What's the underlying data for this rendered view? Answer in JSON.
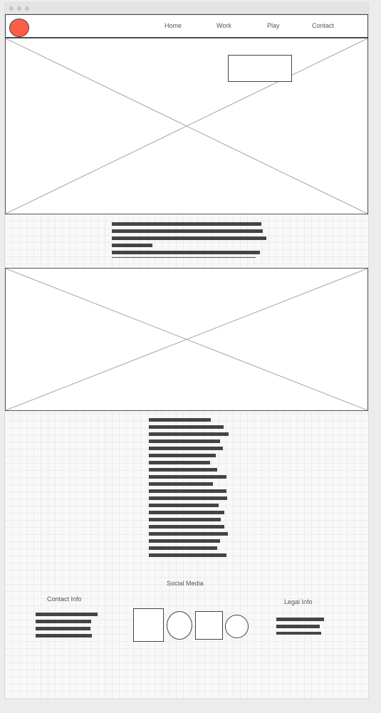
{
  "nav": {
    "items": [
      {
        "label": "Home"
      },
      {
        "label": "Work"
      },
      {
        "label": "Play"
      },
      {
        "label": "Contact"
      }
    ]
  },
  "footer": {
    "contact_title": "Contact Info",
    "social_title": "Social Media",
    "legal_title": "Legal Info"
  },
  "colors": {
    "logo": "#fe5d47",
    "text_bar": "#444444",
    "background": "#f8f8f8"
  }
}
